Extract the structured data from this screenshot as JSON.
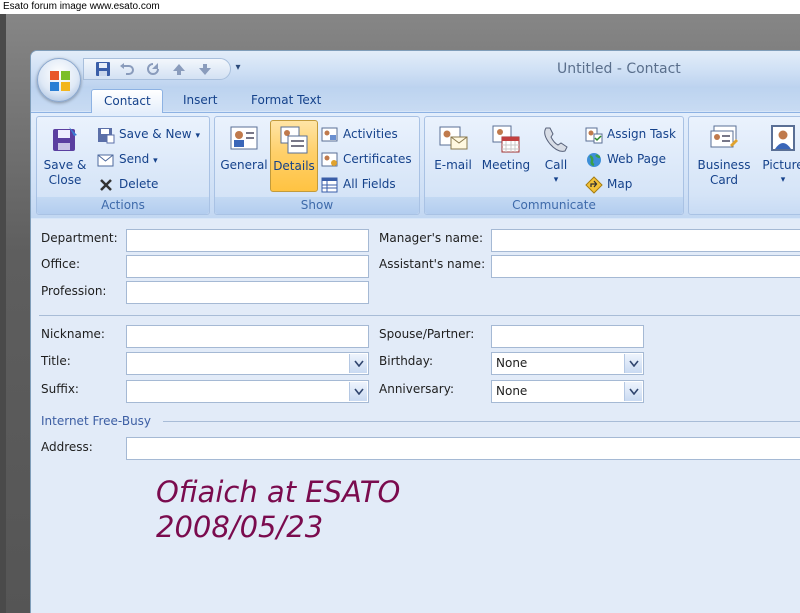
{
  "caption": "Esato forum image www.esato.com",
  "window": {
    "title": "Untitled - Contact"
  },
  "ribbon": {
    "tabs": [
      "Contact",
      "Insert",
      "Format Text"
    ],
    "groups": {
      "actions": {
        "label": "Actions",
        "save_close_line1": "Save &",
        "save_close_line2": "Close",
        "save_new": "Save & New",
        "send": "Send",
        "delete": "Delete"
      },
      "show": {
        "label": "Show",
        "general": "General",
        "details": "Details",
        "activities": "Activities",
        "certificates": "Certificates",
        "all_fields": "All Fields"
      },
      "communicate": {
        "label": "Communicate",
        "email": "E-mail",
        "meeting": "Meeting",
        "call": "Call",
        "assign_task": "Assign Task",
        "web_page": "Web Page",
        "map": "Map"
      },
      "options": {
        "business_card_line1": "Business",
        "business_card_line2": "Card",
        "picture": "Picture"
      }
    }
  },
  "form": {
    "department": {
      "label": "Department:",
      "value": ""
    },
    "office": {
      "label": "Office:",
      "value": ""
    },
    "profession": {
      "label": "Profession:",
      "value": ""
    },
    "managers_name": {
      "label": "Manager's name:",
      "value": ""
    },
    "assistants_name": {
      "label": "Assistant's name:",
      "value": ""
    },
    "nickname": {
      "label": "Nickname:",
      "value": ""
    },
    "title": {
      "label": "Title:",
      "value": ""
    },
    "suffix": {
      "label": "Suffix:",
      "value": ""
    },
    "spouse_partner": {
      "label": "Spouse/Partner:",
      "value": ""
    },
    "birthday": {
      "label": "Birthday:",
      "value": "None"
    },
    "anniversary": {
      "label": "Anniversary:",
      "value": "None"
    },
    "internet_free_busy": "Internet Free-Busy",
    "address": {
      "label": "Address:",
      "value": ""
    }
  },
  "watermark": {
    "line1": "Ofiaich at ESATO",
    "line2": "2008/05/23"
  },
  "colors": {
    "ribbon_text": "#15428b",
    "group_label": "#3e6aaa",
    "watermark": "#7a0b4e",
    "selected_button": "#ffd06a"
  }
}
